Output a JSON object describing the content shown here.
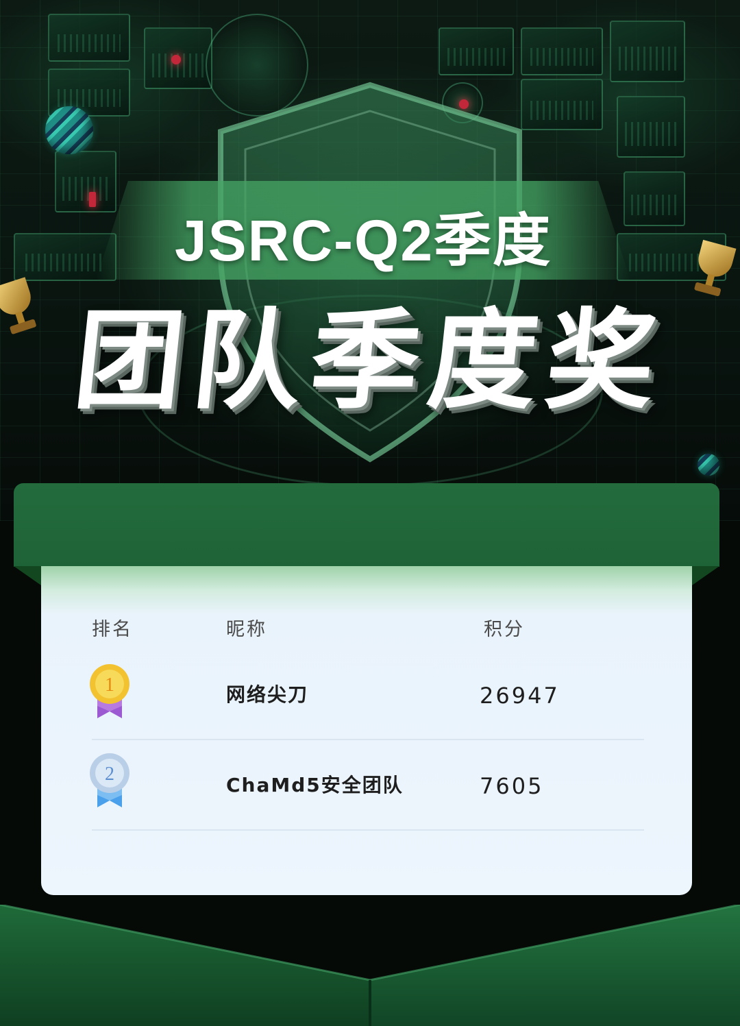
{
  "poster": {
    "subtitle": "JSRC-Q2季度",
    "title": "团队季度奖"
  },
  "leaderboard": {
    "columns": {
      "rank": "排名",
      "nickname": "昵称",
      "score": "积分"
    },
    "rows": [
      {
        "rank": "1",
        "medal": "gold-medal-icon",
        "nickname": "网络尖刀",
        "score": "26947"
      },
      {
        "rank": "2",
        "medal": "silver-medal-icon",
        "nickname": "ChaMd5安全团队",
        "score": "7605"
      }
    ]
  },
  "colors": {
    "accent_green": "#236b3c",
    "card_bg": "#edf5fd",
    "gold": "#f2c230",
    "silver": "#b9cfe8",
    "ribbon_gold": "#9b5ad1",
    "ribbon_silver": "#4aa0ea"
  }
}
